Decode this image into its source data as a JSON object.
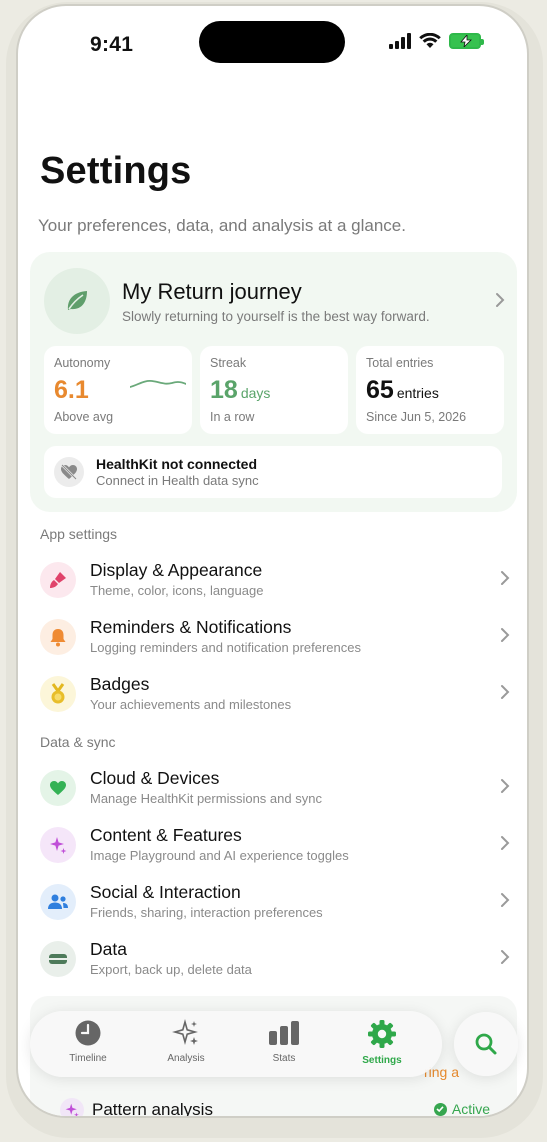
{
  "status_bar": {
    "time": "9:41"
  },
  "header": {
    "title": "Settings",
    "subtitle": "Your preferences, data, and analysis at a glance."
  },
  "journey": {
    "title": "My Return journey",
    "subtitle": "Slowly returning to yourself is the best way forward.",
    "stats": [
      {
        "label": "Autonomy",
        "value": "6.1",
        "unit": "",
        "note": "Above avg",
        "color": "#e8892f"
      },
      {
        "label": "Streak",
        "value": "18",
        "unit": "days",
        "note": "In a row",
        "color": "#5aa46a"
      },
      {
        "label": "Total entries",
        "value": "65",
        "unit": "entries",
        "note": "Since Jun 5, 2026",
        "color": "#111111"
      }
    ],
    "healthkit": {
      "title": "HealthKit not connected",
      "subtitle": "Connect in Health data sync"
    }
  },
  "sections": {
    "app_settings": {
      "header": "App settings",
      "items": [
        {
          "title": "Display & Appearance",
          "subtitle": "Theme, color, icons, language",
          "icon": "paintbrush-icon"
        },
        {
          "title": "Reminders & Notifications",
          "subtitle": "Logging reminders and notification preferences",
          "icon": "bell-icon"
        },
        {
          "title": "Badges",
          "subtitle": "Your achievements and milestones",
          "icon": "medal-icon"
        }
      ]
    },
    "data_sync": {
      "header": "Data & sync",
      "items": [
        {
          "title": "Cloud & Devices",
          "subtitle": "Manage HealthKit permissions and sync",
          "icon": "heart-icon"
        },
        {
          "title": "Content & Features",
          "subtitle": "Image Playground and AI experience toggles",
          "icon": "sparkles-icon"
        },
        {
          "title": "Social & Interaction",
          "subtitle": "Friends, sharing, interaction preferences",
          "icon": "people-icon"
        },
        {
          "title": "Data",
          "subtitle": "Export, back up, delete data",
          "icon": "drive-icon"
        }
      ]
    }
  },
  "peek": {
    "title": "Pattern analysis",
    "status": "Active",
    "partial_status": "ring a"
  },
  "tabbar": {
    "tabs": [
      {
        "label": "Timeline",
        "icon": "clock-icon"
      },
      {
        "label": "Analysis",
        "icon": "sparkles-icon"
      },
      {
        "label": "Stats",
        "icon": "bar-chart-icon"
      },
      {
        "label": "Settings",
        "icon": "gear-icon",
        "active": true
      }
    ],
    "search_icon": "search-icon"
  },
  "colors": {
    "accent": "#2fa84a",
    "orange": "#e8892f"
  }
}
